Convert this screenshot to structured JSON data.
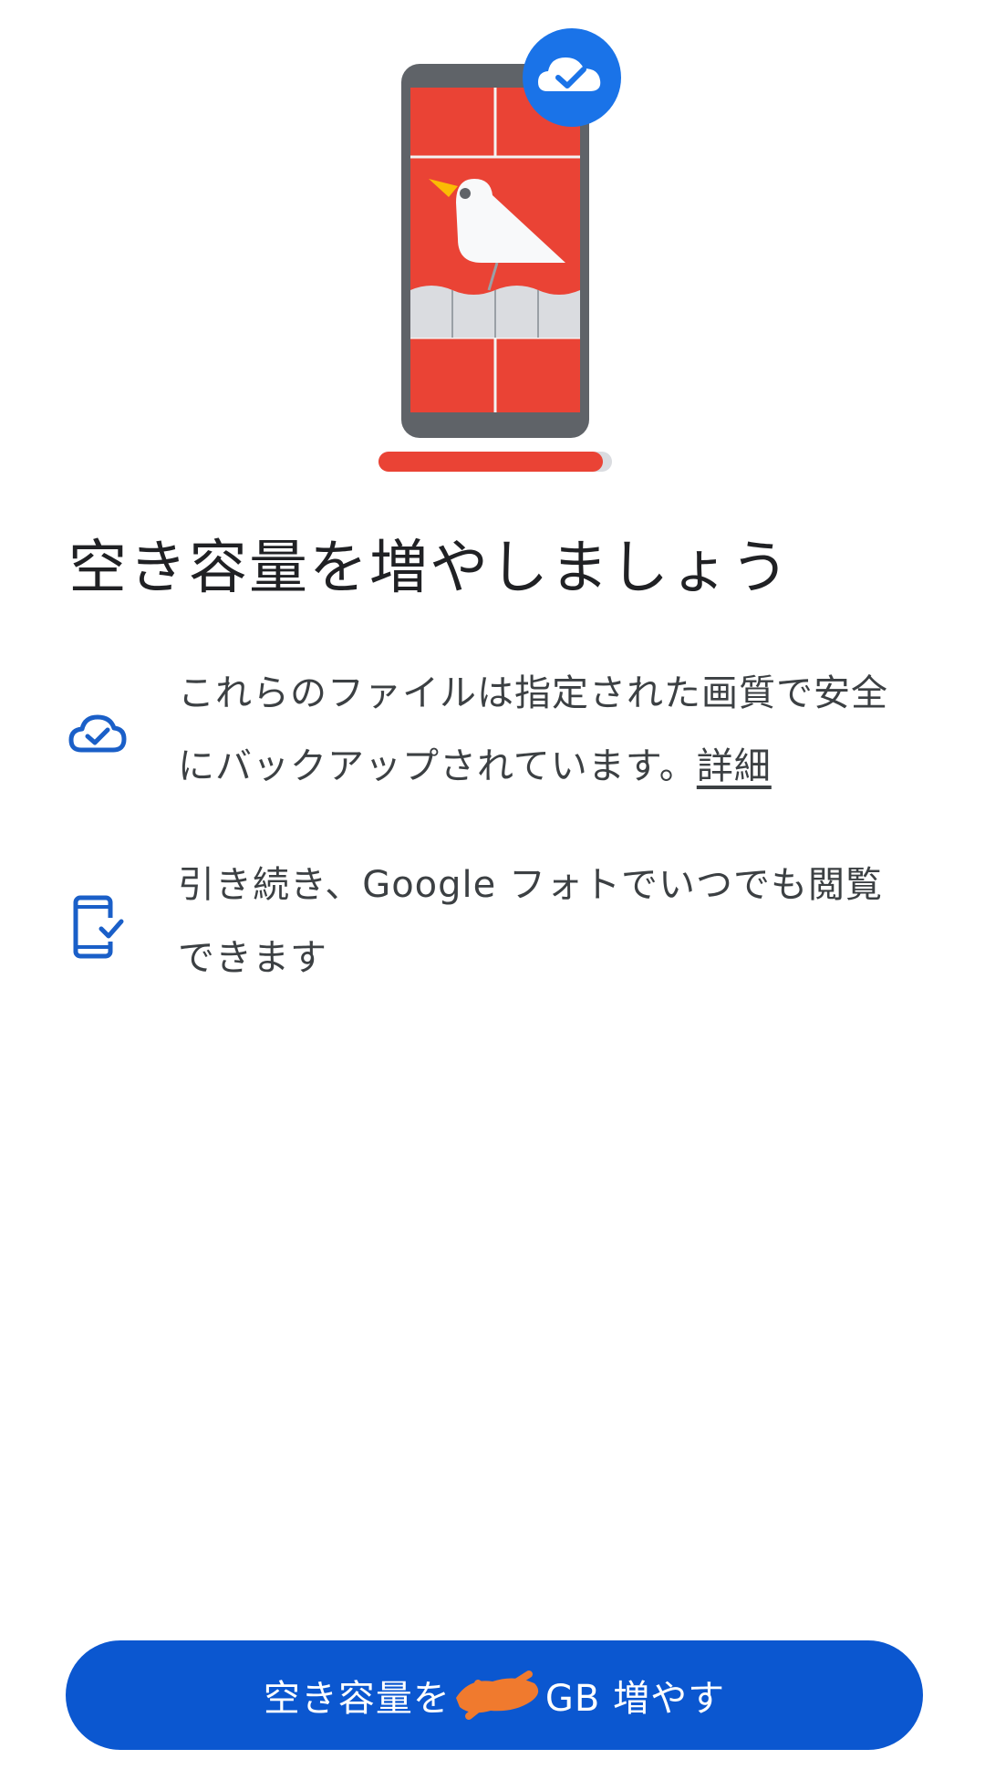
{
  "heading": {
    "title": "空き容量を増やしましょう"
  },
  "features": [
    {
      "icon": "cloud-check-icon",
      "text": "これらのファイルは指定された画質で安全にバックアップされています。",
      "link_label": "詳細"
    },
    {
      "icon": "phone-check-icon",
      "text": "引き続き、Google フォトでいつでも閲覧できます"
    }
  ],
  "cta": {
    "label_prefix": "空き容量を",
    "label_suffix": "GB 増やす"
  },
  "colors": {
    "accent": "#0b57d0",
    "icon_blue": "#1a5fc8",
    "illustration_red": "#ea4335",
    "phone_frame": "#5f6368",
    "badge_blue": "#1a73e8",
    "redaction": "#f07a2e"
  }
}
